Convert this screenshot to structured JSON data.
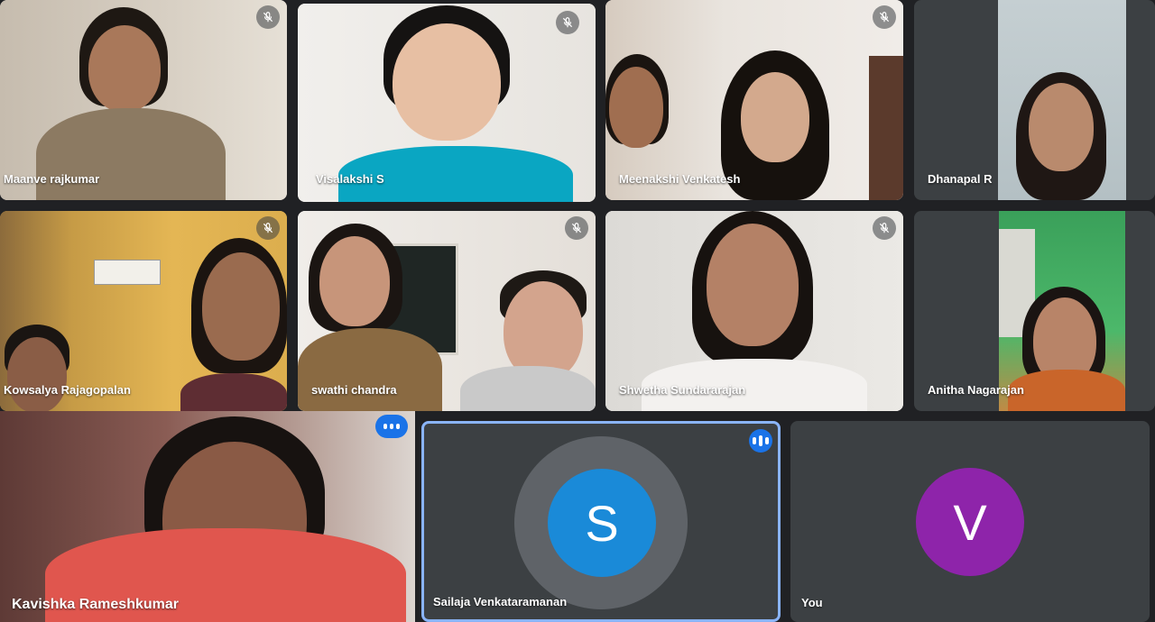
{
  "participants": [
    {
      "name": "Maanve rajkumar",
      "muted": true
    },
    {
      "name": "Visalakshi S",
      "muted": true
    },
    {
      "name": "Meenakshi Venkatesh",
      "muted": true
    },
    {
      "name": "Dhanapal R",
      "muted": false
    },
    {
      "name": "Kowsalya Rajagopalan",
      "muted": true
    },
    {
      "name": "swathi chandra",
      "muted": true
    },
    {
      "name": "Shwetha Sundararajan",
      "muted": true
    },
    {
      "name": "Anitha Nagarajan",
      "muted": false
    },
    {
      "name": "Kavishka Rameshkumar",
      "speaking": true
    },
    {
      "name": "Sailaja Venkataramanan",
      "avatar_letter": "S",
      "avatar_color": "#1a8ad8",
      "speaking": true
    },
    {
      "name": "You",
      "avatar_letter": "V",
      "avatar_color": "#8e24aa"
    }
  ],
  "colors": {
    "background": "#202124",
    "tile": "#3c4043",
    "active_border": "#8ab4f8",
    "speaking_indicator": "#1a73e8"
  },
  "icons": {
    "muted": "mic-off-icon",
    "speaking": "audio-level-icon"
  }
}
